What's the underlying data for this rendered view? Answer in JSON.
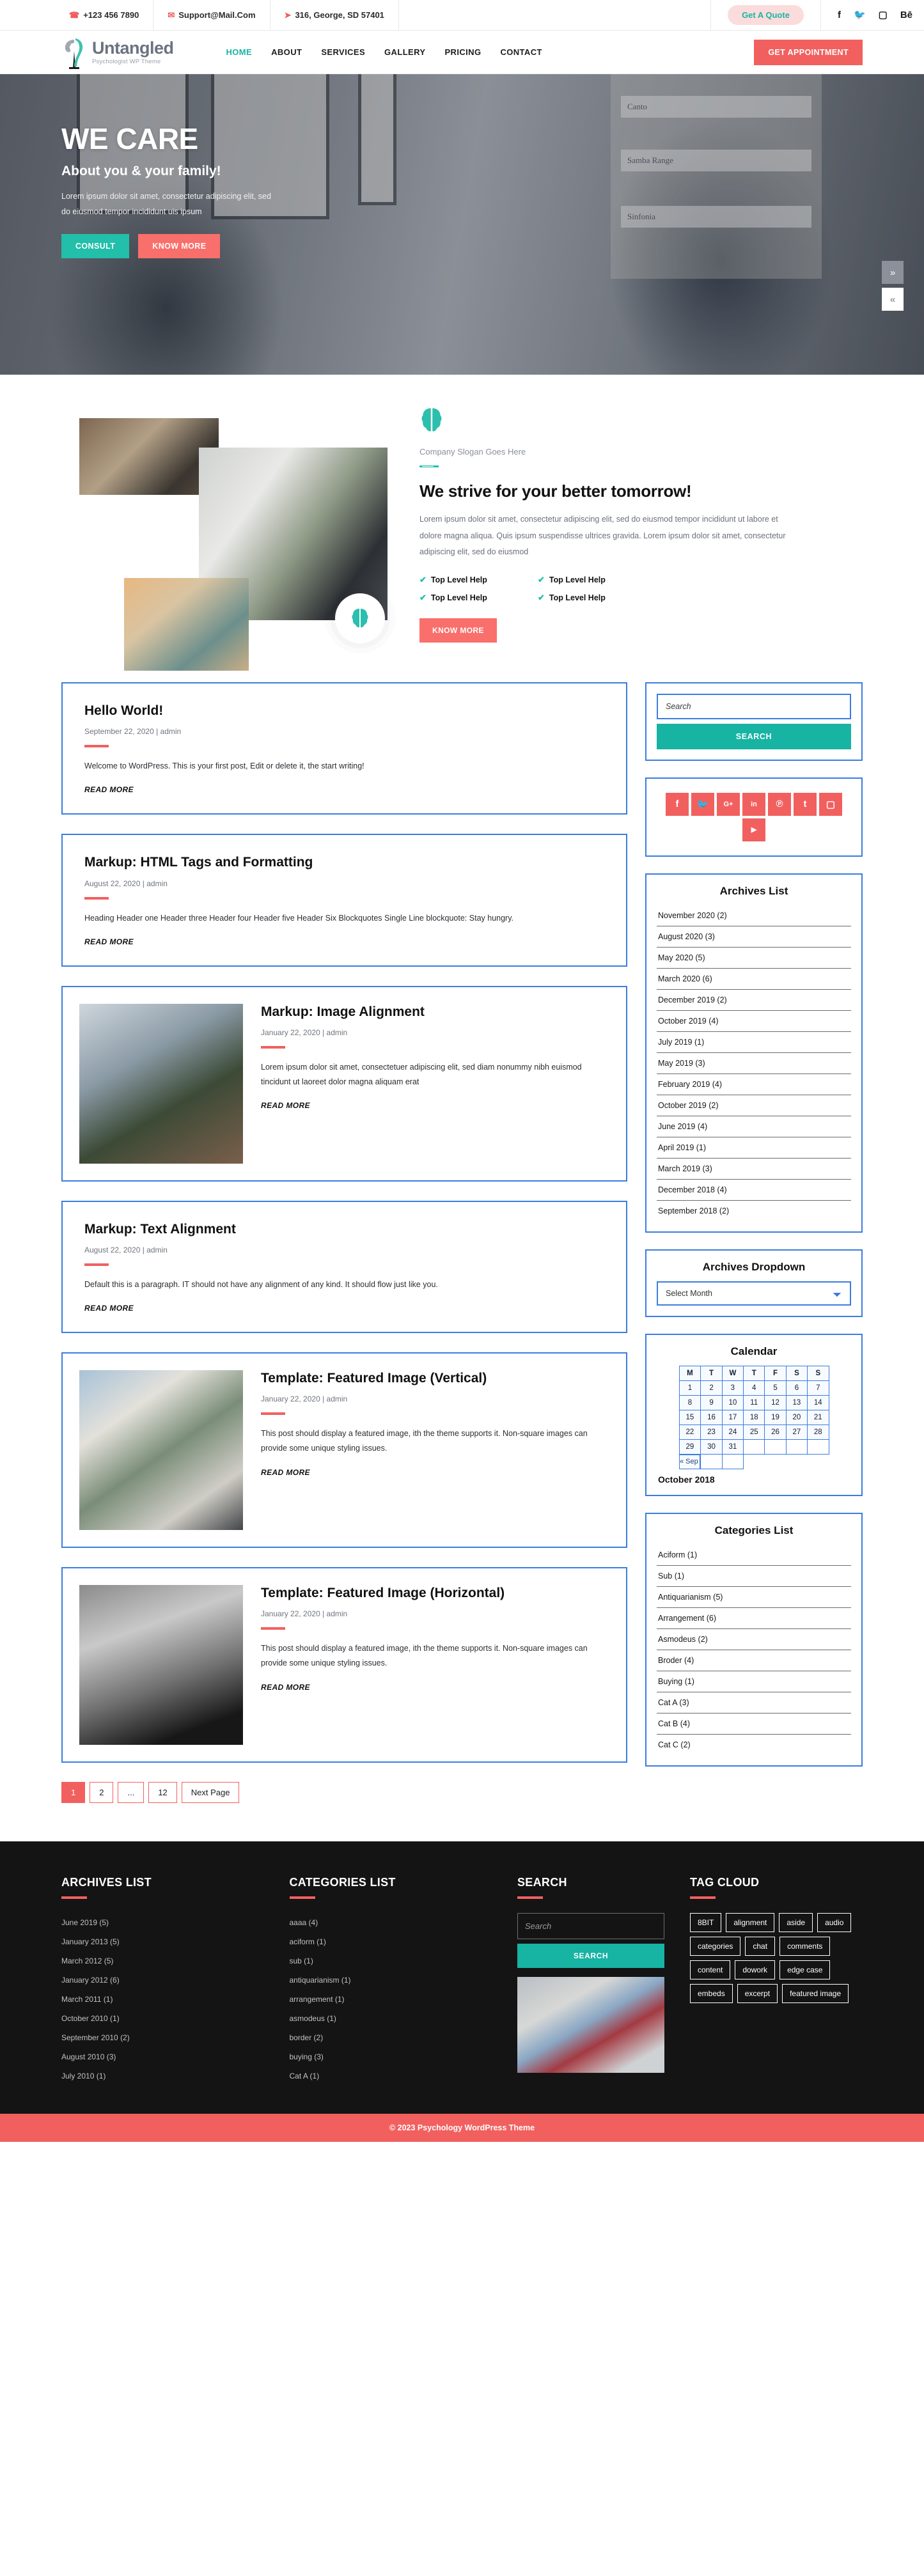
{
  "topbar": {
    "phone": "+123 456 7890",
    "email": "Support@Mail.Com",
    "address": "316, George, SD 57401",
    "quote_label": "Get A Quote",
    "socials": [
      {
        "name": "facebook-icon",
        "glyph": "f"
      },
      {
        "name": "twitter-icon",
        "glyph": "🐦"
      },
      {
        "name": "instagram-icon",
        "glyph": "▢"
      },
      {
        "name": "behance-icon",
        "glyph": "Bē"
      }
    ]
  },
  "nav": {
    "brand_name": "Untangled",
    "brand_sub": "Psychologist WP Theme",
    "menu": [
      {
        "label": "HOME",
        "active": true
      },
      {
        "label": "ABOUT",
        "active": false
      },
      {
        "label": "SERVICES",
        "active": false
      },
      {
        "label": "GALLERY",
        "active": false
      },
      {
        "label": "PRICING",
        "active": false
      },
      {
        "label": "CONTACT",
        "active": false
      }
    ],
    "appointment_label": "GET APPOINTMENT"
  },
  "hero": {
    "heading": "WE CARE",
    "subheading": "About you & your family!",
    "paragraph": "Lorem ipsum dolor sit amet, consectetur adipiscing elit, sed do eiusmod tempor incididunt uis ipsum",
    "btn_primary": "CONSULT",
    "btn_secondary": "KNOW MORE",
    "next_glyph": "»",
    "prev_glyph": "«",
    "shelf_labels": [
      "Canto",
      "Samba Range",
      "Sinfonia"
    ]
  },
  "about": {
    "slogan": "Company Slogan Goes Here",
    "heading": "We strive for your better tomorrow!",
    "paragraph": "Lorem ipsum dolor sit amet, consectetur adipiscing elit, sed do eiusmod tempor incididunt ut labore et dolore magna aliqua. Quis ipsum suspendisse ultrices gravida. Lorem ipsum dolor sit amet, consectetur adipiscing elit, sed do eiusmod",
    "features": [
      "Top Level Help",
      "Top Level Help",
      "Top Level Help",
      "Top Level Help"
    ],
    "button": "KNOW MORE"
  },
  "posts": [
    {
      "title": "Hello World!",
      "meta": "September 22, 2020 | admin",
      "excerpt": "Welcome to WordPress. This is your first post, Edit or delete it, the start writing!",
      "read_more": "READ MORE",
      "has_image": false
    },
    {
      "title": "Markup: HTML Tags and Formatting",
      "meta": "August 22, 2020 | admin",
      "excerpt": "Heading Header one Header three Header four Header five Header Six Blockquotes Single Line blockquote: Stay hungry.",
      "read_more": "READ MORE",
      "has_image": false
    },
    {
      "title": "Markup: Image Alignment",
      "meta": "January 22, 2020 | admin",
      "excerpt": "Lorem ipsum dolor sit amet, consectetuer adipiscing elit, sed diam nonummy nibh euismod tincidunt ut laoreet dolor magna aliquam erat",
      "read_more": "READ MORE",
      "has_image": true
    },
    {
      "title": "Markup: Text Alignment",
      "meta": "August 22, 2020 | admin",
      "excerpt": "Default this is a paragraph. IT should not have any alignment of any kind. It should flow just like you.",
      "read_more": "READ MORE",
      "has_image": false
    },
    {
      "title": "Template: Featured Image (Vertical)",
      "meta": "January 22, 2020 | admin",
      "excerpt": "This post should display a featured image, ith the theme supports it. Non-square images can provide some unique styling issues.",
      "read_more": "READ MORE",
      "has_image": true
    },
    {
      "title": "Template: Featured Image (Horizontal)",
      "meta": "January 22, 2020 | admin",
      "excerpt": "This post should display a featured image, ith the theme supports it. Non-square images can provide some unique styling issues.",
      "read_more": "READ MORE",
      "has_image": true
    }
  ],
  "pagination": [
    {
      "label": "1",
      "active": true
    },
    {
      "label": "2",
      "active": false
    },
    {
      "label": "...",
      "active": false
    },
    {
      "label": "12",
      "active": false
    },
    {
      "label": "Next Page",
      "active": false
    }
  ],
  "sidebar": {
    "search": {
      "placeholder": "Search",
      "value": "",
      "button": "SEARCH"
    },
    "socials": [
      {
        "name": "facebook-icon",
        "glyph": "f"
      },
      {
        "name": "twitter-icon",
        "glyph": "🐦"
      },
      {
        "name": "google-plus-icon",
        "glyph": "G+"
      },
      {
        "name": "linkedin-icon",
        "glyph": "in"
      },
      {
        "name": "pinterest-icon",
        "glyph": "℗"
      },
      {
        "name": "tumblr-icon",
        "glyph": "t"
      },
      {
        "name": "instagram-icon",
        "glyph": "▢"
      },
      {
        "name": "youtube-icon",
        "glyph": "▶"
      }
    ],
    "archives_title": "Archives List",
    "archives": [
      "November 2020 (2)",
      "August 2020 (3)",
      "May 2020 (5)",
      "March 2020 (6)",
      "December 2019 (2)",
      "October 2019 (4)",
      "July 2019 (1)",
      "May 2019 (3)",
      "February 2019 (4)",
      "October 2019 (2)",
      "June 2019 (4)",
      "April 2019 (1)",
      "March 2019 (3)",
      "December 2018 (4)",
      "September 2018 (2)"
    ],
    "dropdown_title": "Archives Dropdown",
    "dropdown_selected": "Select Month",
    "calendar": {
      "title": "Calendar",
      "weekdays": [
        "M",
        "T",
        "W",
        "T",
        "F",
        "S",
        "S"
      ],
      "weeks": [
        [
          "1",
          "2",
          "3",
          "4",
          "5",
          "6",
          "7"
        ],
        [
          "8",
          "9",
          "10",
          "11",
          "12",
          "13",
          "14"
        ],
        [
          "15",
          "16",
          "17",
          "18",
          "19",
          "20",
          "21"
        ],
        [
          "22",
          "23",
          "24",
          "25",
          "26",
          "27",
          "28"
        ],
        [
          "29",
          "30",
          "31",
          "",
          "",
          "",
          ""
        ]
      ],
      "prev_label": "« Sep",
      "month_label": "October 2018"
    },
    "categories_title": "Categories List",
    "categories": [
      "Aciform (1)",
      "Sub (1)",
      "Antiquarianism (5)",
      "Arrangement (6)",
      "Asmodeus (2)",
      "Broder (4)",
      "Buying (1)",
      "Cat A (3)",
      "Cat B (4)",
      "Cat C (2)"
    ]
  },
  "footer": {
    "archives_title": "ARCHIVES LIST",
    "archives": [
      "June 2019 (5)",
      "January  2013 (5)",
      "March 2012 (5)",
      "January  2012 (6)",
      "March  2011 (1)",
      "October 2010 (1)",
      "September 2010 (2)",
      "August 2010 (3)",
      "July 2010 (1)"
    ],
    "categories_title": "CATEGORIES LIST",
    "categories": [
      "aaaa (4)",
      "aciform (1)",
      "sub (1)",
      "antiquarianism (1)",
      "arrangement (1)",
      "asmodeus (1)",
      "border (2)",
      "buying (3)",
      "Cat A (1)"
    ],
    "search_title": "SEARCH",
    "search_placeholder": "Search",
    "search_value": "",
    "search_button": "SEARCH",
    "tag_title": "TAG CLOUD",
    "tags": [
      "8BIT",
      "alignment",
      "aside",
      "audio",
      "categories",
      "chat",
      "comments",
      "content",
      "dowork",
      "edge case",
      "embeds",
      "excerpt",
      "featured image"
    ],
    "copyright": "© 2023 Psychology  WordPress Theme"
  },
  "colors": {
    "accent_red": "#f1605f",
    "accent_teal": "#17b3a3",
    "border_blue": "#3b7de0",
    "footer_bg": "#141414"
  }
}
